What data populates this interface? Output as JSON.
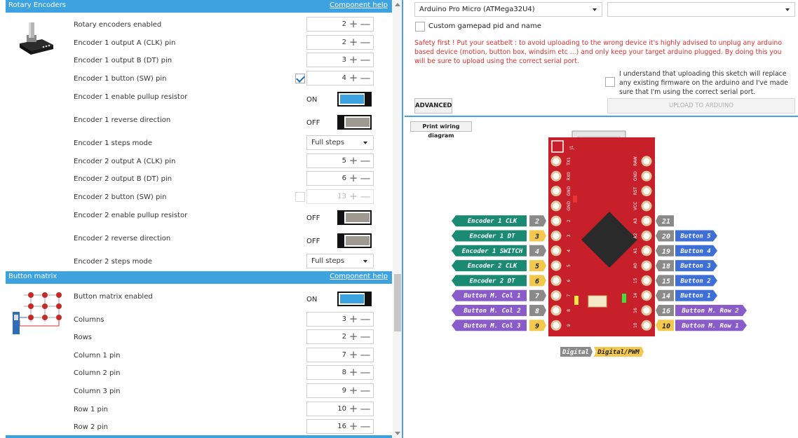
{
  "sections": {
    "rotary": {
      "title": "Rotary Encoders",
      "help": "Component help"
    },
    "matrix": {
      "title": "Button matrix",
      "help": "Component help"
    }
  },
  "rotary_rows": {
    "enabled": {
      "label": "Rotary encoders enabled",
      "value": "2"
    },
    "e1_clk": {
      "label": "Encoder 1 output A (CLK) pin",
      "value": "2"
    },
    "e1_dt": {
      "label": "Encoder 1 output B (DT) pin",
      "value": "3"
    },
    "e1_sw": {
      "label": "Encoder 1 button (SW) pin",
      "value": "4"
    },
    "e1_pullup": {
      "label": "Encoder 1 enable pullup resistor",
      "state": "ON"
    },
    "e1_reverse": {
      "label": "Encoder 1 reverse direction",
      "state": "OFF"
    },
    "e1_steps": {
      "label": "Encoder 1 steps mode",
      "value": "Full steps"
    },
    "e2_clk": {
      "label": "Encoder 2 output A (CLK) pin",
      "value": "5"
    },
    "e2_dt": {
      "label": "Encoder 2 output B (DT) pin",
      "value": "6"
    },
    "e2_sw": {
      "label": "Encoder 2 button (SW) pin",
      "value": "13"
    },
    "e2_pullup": {
      "label": "Encoder 2 enable pullup resistor",
      "state": "OFF"
    },
    "e2_reverse": {
      "label": "Encoder 2 reverse direction",
      "state": "OFF"
    },
    "e2_steps": {
      "label": "Encoder 2 steps mode",
      "value": "Full steps"
    }
  },
  "matrix_rows": {
    "enabled": {
      "label": "Button matrix enabled",
      "state": "ON"
    },
    "columns": {
      "label": "Columns",
      "value": "3"
    },
    "rows": {
      "label": "Rows",
      "value": "2"
    },
    "col1": {
      "label": "Column 1 pin",
      "value": "7"
    },
    "col2": {
      "label": "Column 2 pin",
      "value": "8"
    },
    "col3": {
      "label": "Column 3 pin",
      "value": "9"
    },
    "row1": {
      "label": "Row 1 pin",
      "value": "10"
    },
    "row2": {
      "label": "Row 2 pin",
      "value": "16"
    }
  },
  "controls": {
    "plus": "+",
    "minus": "—"
  },
  "top": {
    "board": "Arduino Pro Micro (ATMega32U4)",
    "port": "",
    "custom_pid": "Custom gamepad pid and name",
    "warning": "Safety first ! Put your seatbelt : to avoid uploading to the wrong device it's highly advised to unplug any arduino based device (motion, button box, windsim etc ...) and only keep your target arduino plugged. By doing this you will be sure to upload using the correct serial port.",
    "agree": "I understand that uploading this sketch will replace any existing firmware on the arduino and I've made sure that I'm using the correct serial port.",
    "advanced": "ADVANCED",
    "upload": "UPLOAD TO ARDUINO"
  },
  "diagram": {
    "print_button": "Print wiring diagram",
    "board_label": "J1",
    "left_pin_labels": [
      "TX1",
      "RX0",
      "GND",
      "GND",
      "2",
      "3",
      "4",
      "5",
      "6",
      "7",
      "8",
      "9"
    ],
    "right_pin_labels": [
      "RAW",
      "GND",
      "RST",
      "VCC",
      "A3",
      "A2",
      "A1",
      "A0",
      "15",
      "14",
      "16",
      "10"
    ],
    "left_tags": [
      {
        "pin": "2",
        "name": "Encoder 1 CLK",
        "kind": "digital"
      },
      {
        "pin": "3",
        "name": "Encoder 1 DT",
        "kind": "pwm"
      },
      {
        "pin": "4",
        "name": "Encoder 1 SWITCH",
        "kind": "digital"
      },
      {
        "pin": "5",
        "name": "Encoder 2 CLK",
        "kind": "pwm"
      },
      {
        "pin": "6",
        "name": "Encoder 2 DT",
        "kind": "pwm"
      },
      {
        "pin": "7",
        "name": "Button M. Col 1",
        "kind": "digital"
      },
      {
        "pin": "8",
        "name": "Button M. Col 2",
        "kind": "digital"
      },
      {
        "pin": "9",
        "name": "Button M. Col 3",
        "kind": "pwm"
      }
    ],
    "right_tags": [
      {
        "pin": "21",
        "name": "",
        "kind": "digital"
      },
      {
        "pin": "20",
        "name": "Button 5",
        "kind": "digital"
      },
      {
        "pin": "19",
        "name": "Button 4",
        "kind": "digital"
      },
      {
        "pin": "18",
        "name": "Button 3",
        "kind": "digital"
      },
      {
        "pin": "15",
        "name": "Button 2",
        "kind": "digital"
      },
      {
        "pin": "14",
        "name": "Button 1",
        "kind": "digital"
      },
      {
        "pin": "16",
        "name": "Button M. Row 2",
        "kind": "digital"
      },
      {
        "pin": "10",
        "name": "Button M. Row 1",
        "kind": "pwm"
      }
    ],
    "legend": {
      "digital": "Digital",
      "pwm": "Digital/PWM"
    },
    "colors": {
      "encoder": "#1a8a72",
      "button": "#3d6fd6",
      "matrix": "#8a5cc9",
      "digital": "#8a8a8a",
      "pwm": "#f2c94c",
      "board": "#c8202b"
    }
  }
}
